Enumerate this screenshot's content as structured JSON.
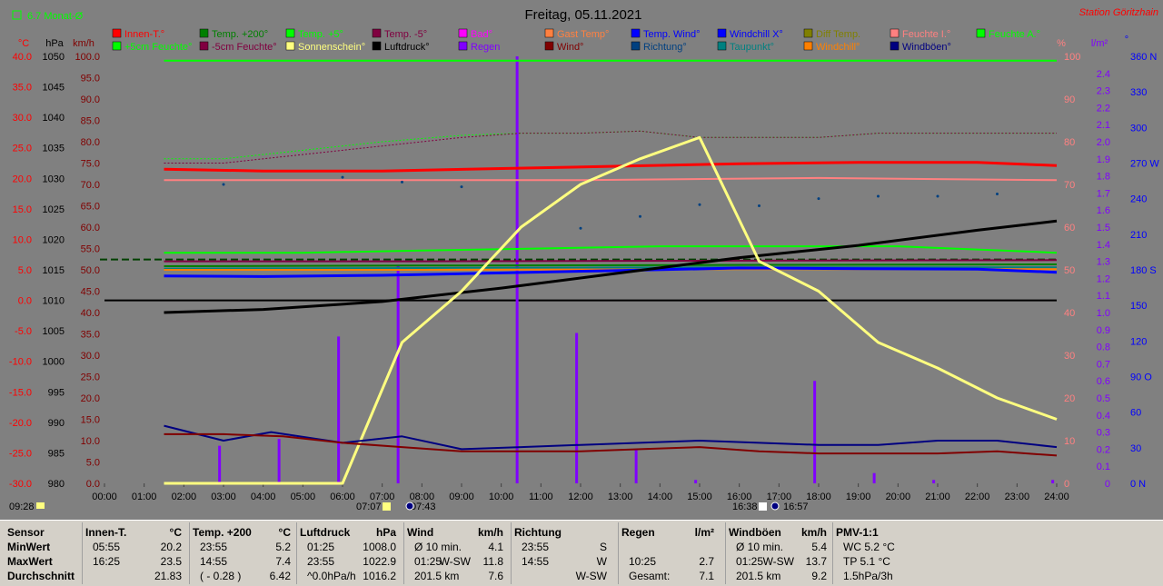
{
  "title": "Freitag, 05.11.2021",
  "station": "Station Göritzhain",
  "monat_label": "6.7 Monat-Ø",
  "legend_row1": [
    {
      "label": "Innen-T.°",
      "color": "#ff0000"
    },
    {
      "label": "Temp. +200°",
      "color": "#008000"
    },
    {
      "label": "Temp. +5°",
      "color": "#00ff00"
    },
    {
      "label": "Temp. -5°",
      "color": "#800040"
    },
    {
      "label": "Bad°",
      "color": "#ff00ff"
    },
    {
      "label": "Gast Temp°",
      "color": "#ff8040"
    },
    {
      "label": "Temp. Wind°",
      "color": "#0000ff"
    },
    {
      "label": "Windchill X°",
      "color": "#0000ff"
    },
    {
      "label": "Diff Temp.",
      "color": "#808000"
    },
    {
      "label": "Feuchte I.°",
      "color": "#ff8080"
    },
    {
      "label": "Feuchte A.°",
      "color": "#00ff00"
    }
  ],
  "legend_row2": [
    {
      "label": "+5cm Feuchte°",
      "color": "#00ff00"
    },
    {
      "label": "-5cm Feuchte°",
      "color": "#800040"
    },
    {
      "label": "Sonnenschein°",
      "color": "#ffff80"
    },
    {
      "label": "Luftdruck°",
      "color": "#000000"
    },
    {
      "label": "Regen",
      "color": "#8000ff"
    },
    {
      "label": "Wind°",
      "color": "#800000"
    },
    {
      "label": "Richtung°",
      "color": "#004080"
    },
    {
      "label": "Taupunkt°",
      "color": "#008080"
    },
    {
      "label": "Windchill°",
      "color": "#ff8000"
    },
    {
      "label": "Windböen°",
      "color": "#000080"
    }
  ],
  "axis_units": {
    "temp": "°C",
    "press": "hPa",
    "wind": "km/h",
    "pct": "%",
    "rain": "l/m²",
    "dir": "°"
  },
  "sun_labels": {
    "rise_time": "07:07",
    "rise_marker": "07:43",
    "set_time": "16:38",
    "set_marker": "16:57",
    "left_marker": "09:28"
  },
  "chart_data": {
    "type": "line",
    "x_range": [
      0,
      24
    ],
    "x_ticks": [
      "00:00",
      "01:00",
      "02:00",
      "03:00",
      "04:00",
      "05:00",
      "06:00",
      "07:00",
      "08:00",
      "09:00",
      "10:00",
      "11:00",
      "12:00",
      "13:00",
      "14:00",
      "15:00",
      "16:00",
      "17:00",
      "18:00",
      "19:00",
      "20:00",
      "21:00",
      "22:00",
      "23:00",
      "24:00"
    ],
    "axes": {
      "temp": {
        "range": [
          -30,
          40
        ],
        "ticks": [
          "40.0",
          "35.0",
          "30.0",
          "25.0",
          "20.0",
          "15.0",
          "10.0",
          "5.0",
          "0.0",
          "-5.0",
          "-10.0",
          "-15.0",
          "-20.0",
          "-25.0",
          "-30.0"
        ]
      },
      "press": {
        "range": [
          980,
          1050
        ],
        "ticks": [
          "1050",
          "1045",
          "1040",
          "1035",
          "1030",
          "1025",
          "1020",
          "1015",
          "1010",
          "1005",
          "1000",
          "995",
          "990",
          "985",
          "980"
        ]
      },
      "wind": {
        "range": [
          0,
          100
        ],
        "ticks": [
          "100.0",
          "95.0",
          "90.0",
          "85.0",
          "80.0",
          "75.0",
          "70.0",
          "65.0",
          "60.0",
          "55.0",
          "50.0",
          "45.0",
          "40.0",
          "35.0",
          "30.0",
          "25.0",
          "20.0",
          "15.0",
          "10.0",
          "5.0",
          "0.0"
        ]
      },
      "pct": {
        "range": [
          0,
          100
        ],
        "ticks": [
          "100",
          "90",
          "80",
          "70",
          "60",
          "50",
          "40",
          "30",
          "20",
          "10",
          "0"
        ]
      },
      "rain": {
        "range": [
          0,
          2.5
        ],
        "ticks": [
          "2.4",
          "2.3",
          "2.2",
          "2.1",
          "2.0",
          "1.9",
          "1.8",
          "1.7",
          "1.6",
          "1.5",
          "1.4",
          "1.3",
          "1.2",
          "1.1",
          "1.0",
          "0.9",
          "0.8",
          "0.7",
          "0.6",
          "0.5",
          "0.4",
          "0.3",
          "0.2",
          "0.1",
          "0"
        ]
      },
      "dir": {
        "range": [
          0,
          360
        ],
        "ticks": [
          "360 N",
          "330",
          "300",
          "270 W",
          "240",
          "210",
          "180 S",
          "150",
          "120",
          "90 O",
          "60",
          "30",
          "0 N"
        ]
      }
    },
    "series": [
      {
        "name": "Temp. +5°",
        "axis": "pct",
        "color": "#00ff00",
        "width": 2,
        "x": [
          1.5,
          24
        ],
        "y": [
          99,
          99
        ]
      },
      {
        "name": "Feuchte A.°",
        "axis": "pct",
        "color": "#00ff00",
        "width": 1,
        "dash": "2,2",
        "x": [
          1.5,
          3,
          5,
          7,
          9,
          10.5,
          12,
          13.5,
          15,
          16.5,
          18,
          19.5,
          21,
          22.5,
          24
        ],
        "y": [
          76,
          76,
          78,
          80,
          81.5,
          82,
          82,
          82.5,
          81,
          81,
          81,
          82,
          82,
          82,
          82
        ]
      },
      {
        "name": "-5cm Feuchte°",
        "axis": "pct",
        "color": "#800040",
        "width": 1,
        "dash": "2,2",
        "x": [
          1.5,
          3,
          5,
          7,
          9,
          10.5,
          12,
          13.5,
          15,
          16.5,
          18,
          19.5,
          21,
          22.5,
          24
        ],
        "y": [
          75,
          75,
          77,
          79,
          81,
          82,
          82,
          82.5,
          81,
          81,
          81,
          82,
          82,
          82,
          82
        ]
      },
      {
        "name": "Innen-T.°",
        "axis": "temp",
        "color": "#ff0000",
        "width": 3,
        "x": [
          1.5,
          4,
          7,
          10,
          13,
          16,
          19,
          22,
          24
        ],
        "y": [
          21.5,
          21.2,
          21.2,
          21.6,
          22,
          22.4,
          22.6,
          22.6,
          22.1
        ]
      },
      {
        "name": "Feuchte I.°",
        "axis": "pct",
        "color": "#ff8080",
        "width": 2,
        "x": [
          1.5,
          6,
          12,
          18,
          24
        ],
        "y": [
          71,
          71,
          71,
          71.5,
          71
        ]
      },
      {
        "name": "Temp. -5°",
        "axis": "temp",
        "color": "#800040",
        "width": 2,
        "x": [
          1.5,
          8,
          16,
          24
        ],
        "y": [
          6.4,
          6.4,
          6.5,
          6.6
        ]
      },
      {
        "name": "Temp. +200°",
        "axis": "temp",
        "color": "#008000",
        "width": 2,
        "x": [
          1.5,
          8,
          16,
          24
        ],
        "y": [
          5.6,
          5.7,
          5.8,
          5.9
        ]
      },
      {
        "name": "Taupunkt°",
        "axis": "temp",
        "color": "#008080",
        "width": 2,
        "x": [
          1.5,
          8,
          16,
          24
        ],
        "y": [
          5.2,
          5.3,
          5.4,
          5.4
        ]
      },
      {
        "name": "+5cm Feuchte°",
        "axis": "pct",
        "color": "#00ff00",
        "width": 2,
        "x": [
          1.5,
          5,
          8,
          11,
          14,
          17,
          20,
          24
        ],
        "y": [
          54,
          54,
          54.5,
          55,
          55.5,
          55.5,
          55.5,
          54
        ]
      },
      {
        "name": "Windchill°",
        "axis": "temp",
        "color": "#ff8000",
        "width": 2,
        "x": [
          1.5,
          8,
          16,
          24
        ],
        "y": [
          5,
          5,
          5.1,
          5.1
        ]
      },
      {
        "name": "Temp. Wind°",
        "axis": "temp",
        "color": "#0000ff",
        "width": 3,
        "x": [
          1.5,
          4,
          7,
          10,
          13,
          16,
          19,
          22,
          24
        ],
        "y": [
          4.0,
          3.9,
          4.1,
          4.5,
          4.9,
          5.3,
          5.2,
          5.1,
          4.6
        ]
      },
      {
        "name": "Luftdruck°",
        "axis": "press",
        "color": "#000000",
        "width": 3,
        "x": [
          1.5,
          4,
          7,
          10,
          13,
          16,
          19,
          22,
          24
        ],
        "y": [
          1008.0,
          1008.5,
          1009.8,
          1012.0,
          1014.5,
          1017.0,
          1019.0,
          1021.5,
          1023.0
        ]
      },
      {
        "name": "Sonnenschein°",
        "axis": "pct",
        "color": "#ffff80",
        "width": 3,
        "x": [
          1.5,
          6,
          7.5,
          9,
          10.5,
          12,
          13.5,
          15,
          16.5,
          18,
          19.5,
          21,
          22.5,
          24
        ],
        "y": [
          0,
          0,
          33,
          45,
          60,
          70,
          76,
          81,
          52,
          45,
          33,
          27,
          20,
          15
        ]
      },
      {
        "name": "Windböen°",
        "axis": "wind",
        "color": "#000080",
        "width": 2,
        "x": [
          1.5,
          3,
          4.2,
          6,
          7.5,
          9,
          10.5,
          12,
          13.5,
          15,
          16.5,
          18,
          19.5,
          21,
          22.5,
          24
        ],
        "y": [
          13.5,
          10,
          12,
          9.5,
          11,
          8,
          8.5,
          9,
          9.5,
          10,
          9.5,
          9,
          9,
          10,
          10,
          8.5
        ]
      },
      {
        "name": "Wind°",
        "axis": "wind",
        "color": "#800000",
        "width": 2,
        "x": [
          1.5,
          3,
          4.5,
          6,
          7.5,
          9,
          10.5,
          12,
          13.5,
          15,
          16.5,
          18,
          19.5,
          21,
          22.5,
          24
        ],
        "y": [
          11.5,
          11.5,
          11,
          9.5,
          8.5,
          7.5,
          7.5,
          7.5,
          8,
          8.5,
          7.5,
          7,
          7,
          7,
          7.5,
          6.5
        ]
      }
    ],
    "rain_bars": [
      {
        "x": 2.9,
        "v": 0.22
      },
      {
        "x": 4.4,
        "v": 0.26
      },
      {
        "x": 5.9,
        "v": 0.86
      },
      {
        "x": 7.4,
        "v": 1.28
      },
      {
        "x": 10.4,
        "v": 2.5
      },
      {
        "x": 11.9,
        "v": 0.88
      },
      {
        "x": 13.4,
        "v": 0.2
      },
      {
        "x": 14.9,
        "v": 0.02
      },
      {
        "x": 17.9,
        "v": 0.6
      },
      {
        "x": 19.4,
        "v": 0.06
      },
      {
        "x": 20.9,
        "v": 0.02
      },
      {
        "x": 23.9,
        "v": 0.02
      }
    ],
    "direction_dots": {
      "x": [
        3,
        6,
        7.5,
        9,
        12,
        13.5,
        15,
        16.5,
        18,
        19.5,
        21,
        22.5
      ],
      "y": [
        252,
        258,
        254,
        250,
        215,
        225,
        235,
        234,
        240,
        242,
        242,
        244
      ]
    },
    "reference_lines": [
      {
        "axis": "temp",
        "value": 0.0,
        "color": "#000000"
      },
      {
        "axis": "temp",
        "value": 6.7,
        "color": "#004000",
        "dash": "8,4"
      }
    ]
  },
  "stats": [
    {
      "title": "Sensor",
      "unit": "",
      "rows": [
        [
          "MinWert",
          "",
          ""
        ],
        [
          "MaxWert",
          "",
          ""
        ],
        [
          "Durchschnitt",
          "",
          ""
        ]
      ]
    },
    {
      "title": "Innen-T.",
      "unit": "°C",
      "rows": [
        [
          "05:55",
          "",
          "20.2"
        ],
        [
          "16:25",
          "",
          "23.5"
        ],
        [
          "",
          "",
          "21.83"
        ]
      ]
    },
    {
      "title": "Temp. +200",
      "unit": "°C",
      "rows": [
        [
          "23:55",
          "",
          "5.2"
        ],
        [
          "14:55",
          "",
          "7.4"
        ],
        [
          "( - 0.28 )",
          "",
          "6.42"
        ]
      ]
    },
    {
      "title": "Luftdruck",
      "unit": "hPa",
      "rows": [
        [
          "01:25",
          "",
          "1008.0"
        ],
        [
          "23:55",
          "",
          "1022.9"
        ],
        [
          "^0.0hPa/h",
          "",
          "1016.2"
        ]
      ]
    },
    {
      "title": "Wind",
      "unit": "km/h",
      "rows": [
        [
          "Ø 10 min.",
          "",
          "4.1"
        ],
        [
          "01:25",
          "W-SW",
          "11.8"
        ],
        [
          "201.5 km",
          "",
          "7.6"
        ]
      ]
    },
    {
      "title": "Richtung",
      "unit": "",
      "rows": [
        [
          "23:55",
          "",
          "S"
        ],
        [
          "14:55",
          "",
          "W"
        ],
        [
          "",
          "",
          "W-SW"
        ]
      ]
    },
    {
      "title": "Regen",
      "unit": "l/m²",
      "rows": [
        [
          "",
          "",
          ""
        ],
        [
          "10:25",
          "",
          "2.7"
        ],
        [
          "Gesamt:",
          "",
          "7.1"
        ]
      ]
    },
    {
      "title": "Windböen",
      "unit": "km/h",
      "rows": [
        [
          "Ø 10 min.",
          "",
          "5.4"
        ],
        [
          "01:25",
          "W-SW",
          "13.7"
        ],
        [
          "201.5 km",
          "",
          "9.2"
        ]
      ]
    },
    {
      "title": "PMV-1:1",
      "unit": "",
      "rows": [
        [
          "WC 5.2 °C",
          "",
          ""
        ],
        [
          "TP 5.1 °C",
          "",
          ""
        ],
        [
          "1.5hPa/3h",
          "",
          ""
        ]
      ]
    }
  ]
}
